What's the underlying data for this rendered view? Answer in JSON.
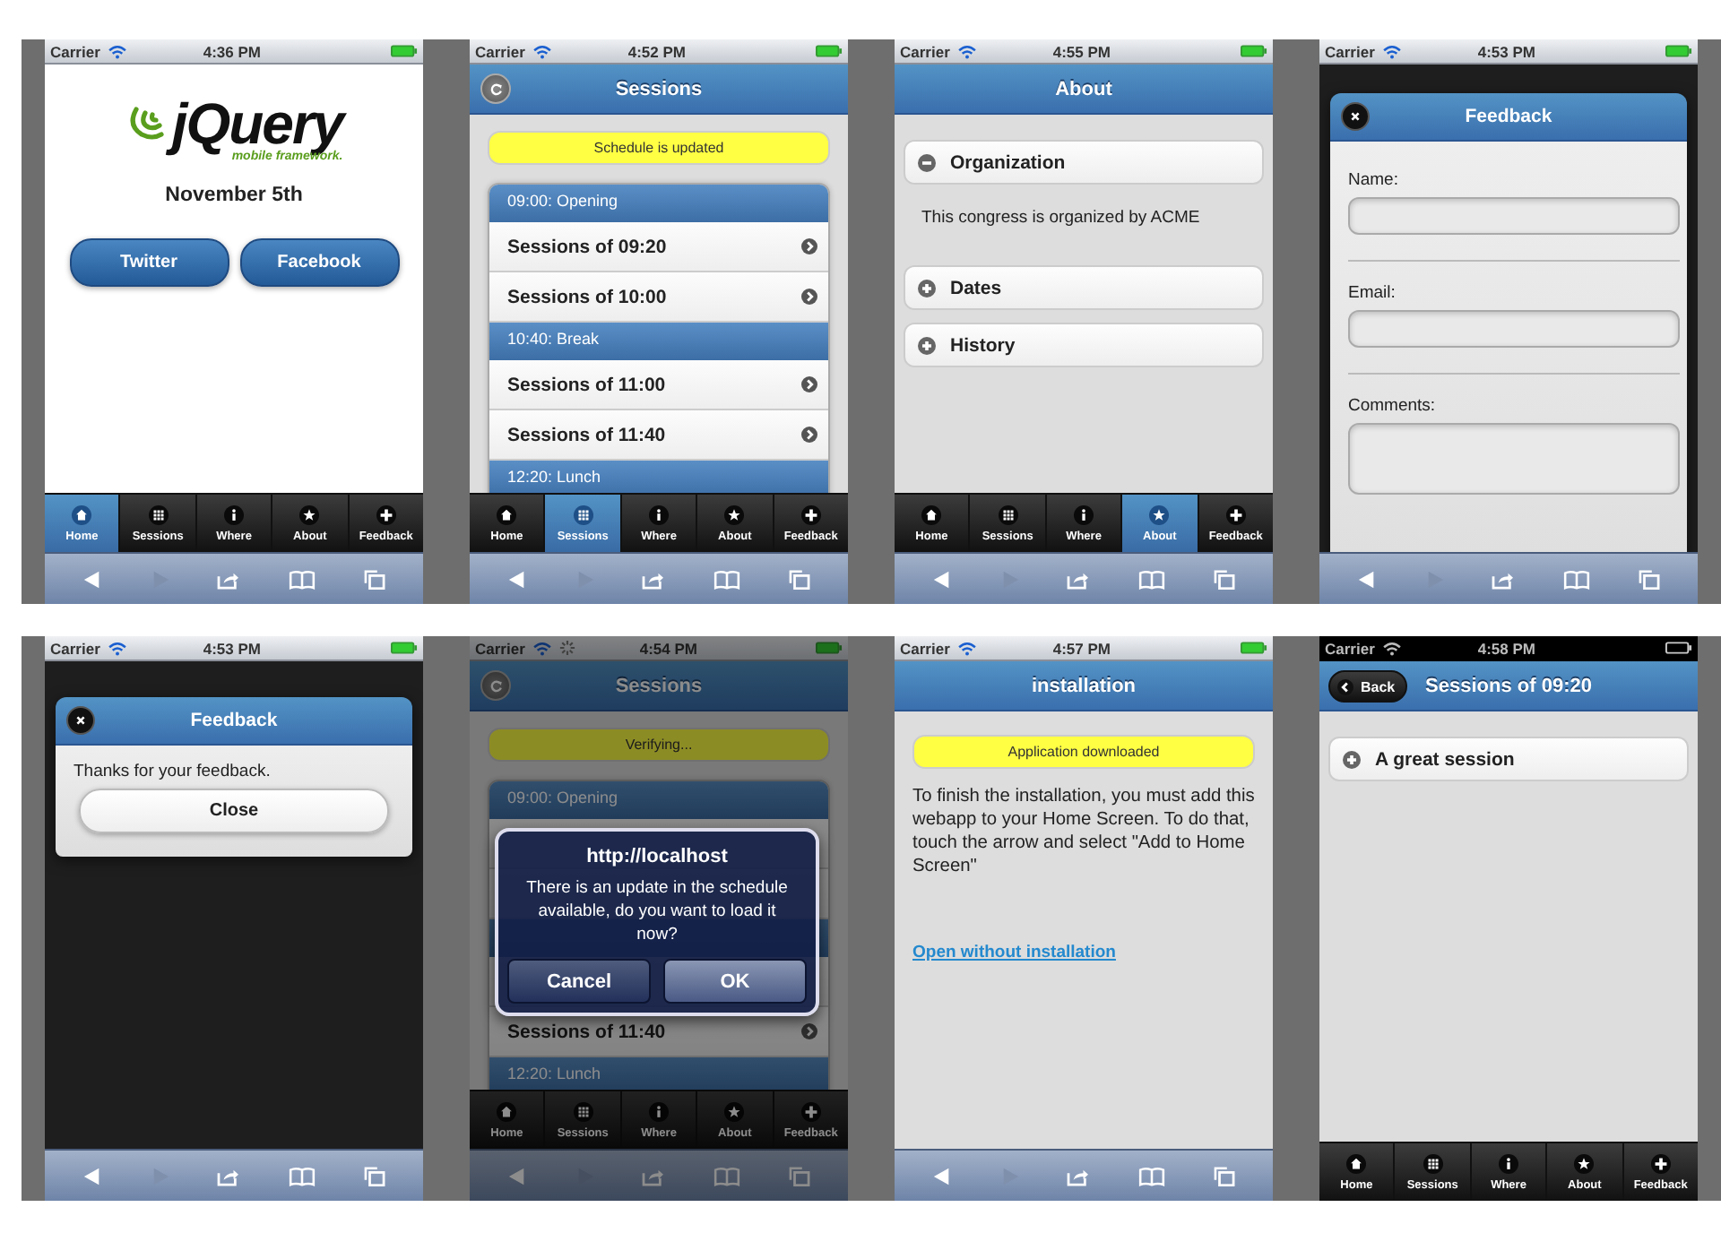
{
  "screens": [
    {
      "kind": "home",
      "status_bar": {
        "carrier": "Carrier",
        "time": "4:36 PM",
        "loading": false,
        "dark": false
      },
      "dimmed": false,
      "browser_toolbar": true,
      "logo": {
        "name": "jQuery",
        "tagline": "mobile framework."
      },
      "date": "November 5th",
      "buttons": [
        "Twitter",
        "Facebook"
      ],
      "tabs": [
        {
          "label": "Home",
          "selected": true
        },
        {
          "label": "Sessions",
          "selected": false
        },
        {
          "label": "Where",
          "selected": false
        },
        {
          "label": "About",
          "selected": false
        },
        {
          "label": "Feedback",
          "selected": false
        }
      ]
    },
    {
      "kind": "list",
      "status_bar": {
        "carrier": "Carrier",
        "time": "4:52 PM",
        "loading": false,
        "dark": false
      },
      "dimmed": false,
      "browser_toolbar": true,
      "header": {
        "title": "Sessions",
        "left_button": {
          "kind": "refresh"
        }
      },
      "notice": "Schedule is updated",
      "items": [
        {
          "kind": "divider",
          "label": "09:00: Opening"
        },
        {
          "kind": "link",
          "label": "Sessions of 09:20"
        },
        {
          "kind": "link",
          "label": "Sessions of 10:00"
        },
        {
          "kind": "divider",
          "label": "10:40: Break"
        },
        {
          "kind": "link",
          "label": "Sessions of 11:00"
        },
        {
          "kind": "link",
          "label": "Sessions of 11:40"
        },
        {
          "kind": "divider",
          "label": "12:20: Lunch"
        }
      ],
      "tabs": [
        {
          "label": "Home",
          "selected": false
        },
        {
          "label": "Sessions",
          "selected": true
        },
        {
          "label": "Where",
          "selected": false
        },
        {
          "label": "About",
          "selected": false
        },
        {
          "label": "Feedback",
          "selected": false
        }
      ]
    },
    {
      "kind": "collapsibles",
      "status_bar": {
        "carrier": "Carrier",
        "time": "4:55 PM",
        "loading": false,
        "dark": false
      },
      "dimmed": false,
      "browser_toolbar": true,
      "header": {
        "title": "About"
      },
      "sections": [
        {
          "title": "Organization",
          "expanded": true,
          "content": "This congress is organized by ACME"
        },
        {
          "title": "Dates",
          "expanded": false
        },
        {
          "title": "History",
          "expanded": false
        }
      ],
      "tabs": [
        {
          "label": "Home",
          "selected": false
        },
        {
          "label": "Sessions",
          "selected": false
        },
        {
          "label": "Where",
          "selected": false
        },
        {
          "label": "About",
          "selected": true
        },
        {
          "label": "Feedback",
          "selected": false
        }
      ]
    },
    {
      "kind": "form-dialog",
      "status_bar": {
        "carrier": "Carrier",
        "time": "4:53 PM",
        "loading": false,
        "dark": false
      },
      "dimmed": false,
      "browser_toolbar": true,
      "dialog": {
        "title": "Feedback",
        "fields": [
          {
            "label": "Name:",
            "kind": "input"
          },
          {
            "label": "Email:",
            "kind": "input"
          },
          {
            "label": "Comments:",
            "kind": "textarea"
          }
        ]
      }
    },
    {
      "kind": "message-dialog",
      "status_bar": {
        "carrier": "Carrier",
        "time": "4:53 PM",
        "loading": false,
        "dark": false
      },
      "dimmed": false,
      "browser_toolbar": true,
      "dialog": {
        "title": "Feedback",
        "message": "Thanks for your feedback.",
        "button": "Close"
      }
    },
    {
      "kind": "list",
      "status_bar": {
        "carrier": "Carrier",
        "time": "4:54 PM",
        "loading": true,
        "dark": false
      },
      "dimmed": true,
      "browser_toolbar": true,
      "header": {
        "title": "Sessions",
        "left_button": {
          "kind": "refresh"
        }
      },
      "notice": "Verifying...",
      "items": [
        {
          "kind": "divider",
          "label": "09:00: Opening"
        },
        {
          "kind": "covered-link"
        },
        {
          "kind": "covered-link"
        },
        {
          "kind": "covered-divider"
        },
        {
          "kind": "covered-link"
        },
        {
          "kind": "link",
          "label": "Sessions of 11:40"
        },
        {
          "kind": "divider",
          "label": "12:20: Lunch"
        }
      ],
      "alert": {
        "title": "http://localhost",
        "message": "There is an update in the schedule available, do you want to load it now?",
        "buttons": [
          {
            "label": "Cancel",
            "kind": "secondary"
          },
          {
            "label": "OK",
            "kind": "primary"
          }
        ]
      },
      "tabs": [
        {
          "label": "Home",
          "selected": false
        },
        {
          "label": "Sessions",
          "selected": false
        },
        {
          "label": "Where",
          "selected": false
        },
        {
          "label": "About",
          "selected": false
        },
        {
          "label": "Feedback",
          "selected": false
        }
      ]
    },
    {
      "kind": "install",
      "status_bar": {
        "carrier": "Carrier",
        "time": "4:57 PM",
        "loading": false,
        "dark": false
      },
      "dimmed": false,
      "browser_toolbar": true,
      "header": {
        "title": "installation"
      },
      "notice": "Application downloaded",
      "paragraph": "To finish the installation, you must add this webapp to your Home Screen. To do that, touch the arrow and select \"Add to Home Screen\"",
      "link": "Open without installation"
    },
    {
      "kind": "collapsibles",
      "status_bar": {
        "carrier": "Carrier",
        "time": "4:58 PM",
        "loading": false,
        "dark": true
      },
      "dimmed": false,
      "browser_toolbar": false,
      "header": {
        "title": "Sessions of 09:20",
        "left_button": {
          "kind": "back",
          "label": "Back"
        }
      },
      "sections": [
        {
          "title": "A great session",
          "expanded": false
        }
      ],
      "tabs": [
        {
          "label": "Home",
          "selected": false
        },
        {
          "label": "Sessions",
          "selected": false
        },
        {
          "label": "Where",
          "selected": false
        },
        {
          "label": "About",
          "selected": false
        },
        {
          "label": "Feedback",
          "selected": false
        }
      ]
    }
  ]
}
